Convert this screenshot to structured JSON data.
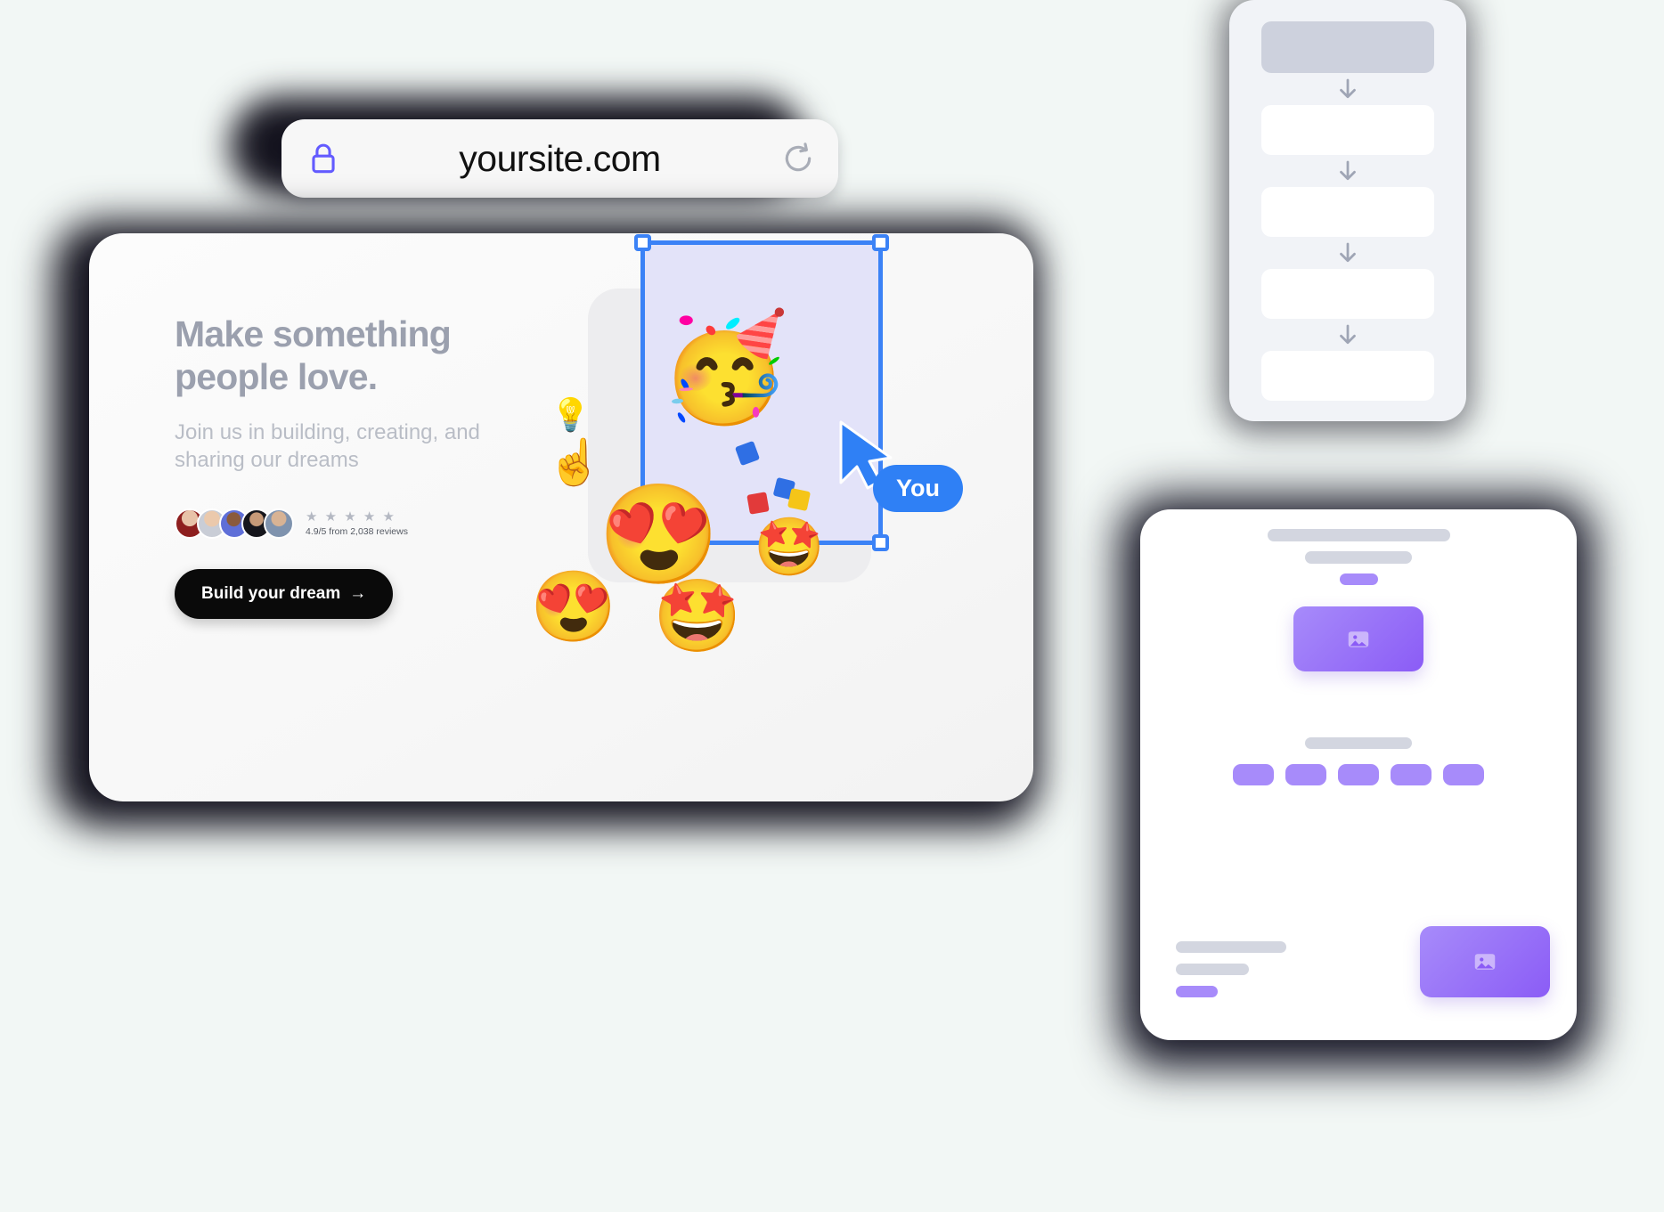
{
  "browser": {
    "url": "yoursite.com",
    "lock_icon": "lock-icon",
    "reload_icon": "reload-icon"
  },
  "site": {
    "hero_title": "Make something\npeople love.",
    "hero_subtitle": "Join us in building, creating, and\nsharing our dreams",
    "reviews": {
      "stars": "★ ★ ★ ★ ★",
      "rating_text": "4.9/5 from 2,038 reviews",
      "avatar_count": 5
    },
    "cta_label": "Build your dream",
    "cta_arrow": "→"
  },
  "collab": {
    "cursor_label": "You",
    "cursor_icon": "pointer-cursor-icon",
    "memojis": [
      {
        "name": "memoji-party-face",
        "glyph": "🥳"
      },
      {
        "name": "memoji-pointing-up",
        "glyph": "☝️"
      },
      {
        "name": "memoji-idea-bulb",
        "glyph": "💡"
      },
      {
        "name": "memoji-heart-eyes-curly",
        "glyph": "😍"
      },
      {
        "name": "memoji-star-struck-cap",
        "glyph": "🤩"
      },
      {
        "name": "memoji-heart-eyes-beanie",
        "glyph": "😍"
      },
      {
        "name": "memoji-star-struck-gold",
        "glyph": "🤩"
      }
    ],
    "confetti_colors": [
      "#E23A3A",
      "#F5C518",
      "#2F6FE4",
      "#2F6FE4",
      "#F5C518"
    ]
  },
  "flow_panel": {
    "header_block": "flow-header-block",
    "blocks": 4,
    "arrow_icon": "arrow-down-icon"
  },
  "preview_card": {
    "top_lines": [
      "line-long",
      "line-medium",
      "pill-accent"
    ],
    "hero_image_icon": "image-placeholder-icon",
    "mid_line": "line-medium",
    "pills": 5,
    "bottom_lines": [
      "line-long",
      "line-medium",
      "pill-accent"
    ],
    "bottom_image_icon": "image-placeholder-icon"
  },
  "colors": {
    "accent_purple": "#8B5CF6",
    "accent_purple_light": "#A78BFA",
    "selection_blue": "#3B82F6",
    "cursor_blue": "#2F80F5",
    "lock_purple": "#635BFF",
    "skeleton_gray": "#D3D6E0",
    "cta_black": "#0A0A0A",
    "page_bg": "#F2F7F5"
  }
}
